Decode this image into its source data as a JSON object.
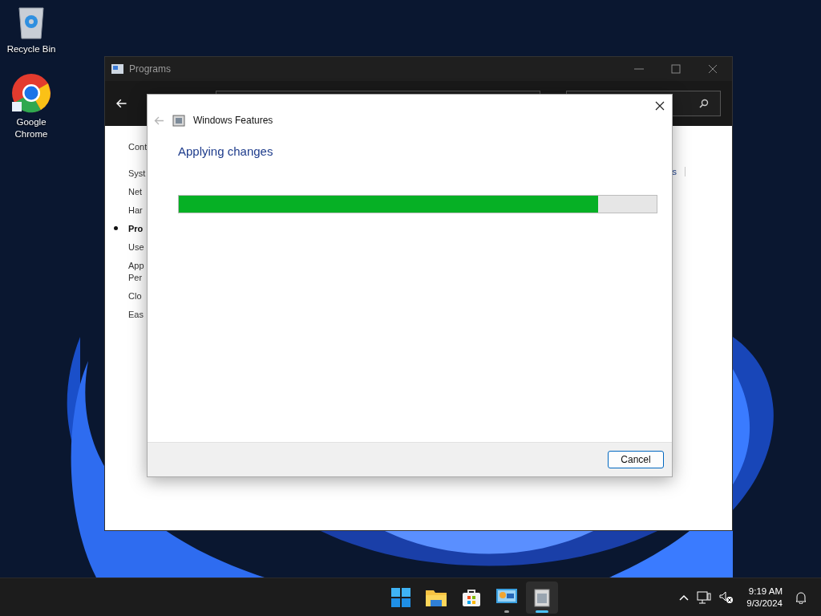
{
  "desktop_icons": [
    {
      "kind": "recycle",
      "label": "Recycle Bin"
    },
    {
      "kind": "chrome",
      "label": "Google Chrome"
    }
  ],
  "programs_window": {
    "title": "Programs",
    "sidebar": [
      {
        "label": "Cont",
        "selected": false
      },
      {
        "label": "Syst",
        "selected": false
      },
      {
        "label": "Net",
        "selected": false
      },
      {
        "label": "Har",
        "selected": false
      },
      {
        "label": "Pro",
        "selected": true
      },
      {
        "label": "Use",
        "selected": false
      },
      {
        "label": "App",
        "selected": false
      },
      {
        "label": "Per",
        "selected": false
      },
      {
        "label": "Clo",
        "selected": false
      },
      {
        "label": "Eas",
        "selected": false
      }
    ],
    "right_link": "s"
  },
  "dialog": {
    "title": "Windows Features",
    "back_disabled": true,
    "heading": "Applying changes",
    "progress": {
      "level": 0.877
    },
    "cancel": "Cancel"
  },
  "taskbar": {
    "apps": [
      {
        "kind": "start",
        "running": false,
        "selected": false
      },
      {
        "kind": "explorer",
        "running": false,
        "selected": false
      },
      {
        "kind": "store",
        "running": false,
        "selected": false
      },
      {
        "kind": "control",
        "running": true,
        "selected": false
      },
      {
        "kind": "features",
        "running": true,
        "selected": true
      }
    ],
    "time": "9:19 AM",
    "date": "9/3/2024"
  }
}
